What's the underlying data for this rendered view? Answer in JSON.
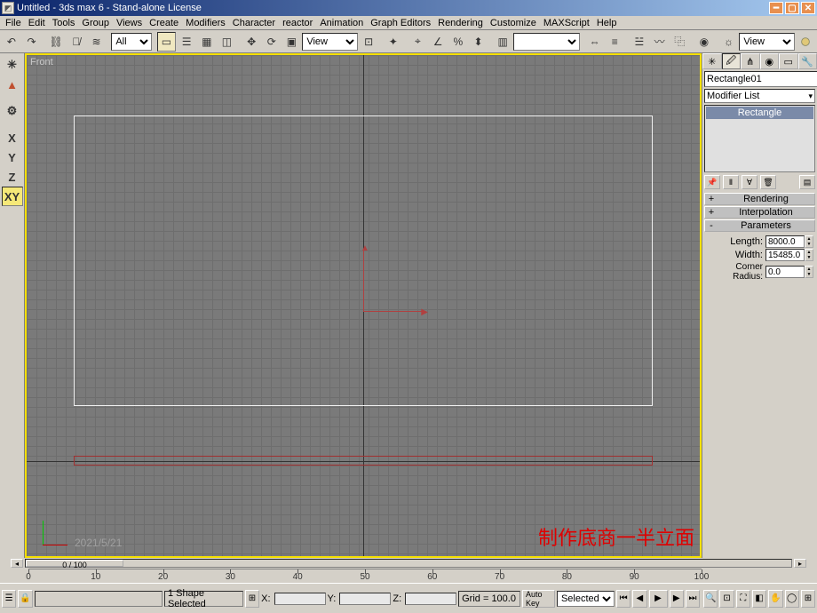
{
  "title": "Untitled - 3ds max 6 - Stand-alone License",
  "menu": [
    "File",
    "Edit",
    "Tools",
    "Group",
    "Views",
    "Create",
    "Modifiers",
    "Character",
    "reactor",
    "Animation",
    "Graph Editors",
    "Rendering",
    "Customize",
    "MAXScript",
    "Help"
  ],
  "toolbar": {
    "selset": "All",
    "refcoord": "View",
    "renderview": "View"
  },
  "axis": {
    "x": "X",
    "y": "Y",
    "z": "Z",
    "xy": "XY"
  },
  "viewport": {
    "label": "Front",
    "overlay_text": "制作底商一半立面",
    "watermark": "2021/5/21"
  },
  "cmd": {
    "object_name": "Rectangle01",
    "modlist_label": "Modifier List",
    "stack_item": "Rectangle",
    "rollouts": {
      "rendering": "Rendering",
      "interpolation": "Interpolation",
      "parameters": "Parameters"
    },
    "params": {
      "length_label": "Length:",
      "length": "8000.0",
      "width_label": "Width:",
      "width": "15485.0",
      "corner_label": "Corner Radius:",
      "corner": "0.0"
    }
  },
  "timeline": {
    "thumb": "0 / 100",
    "ticks": [
      "0",
      "10",
      "20",
      "30",
      "40",
      "50",
      "60",
      "70",
      "80",
      "90",
      "100"
    ]
  },
  "status": {
    "selinfo": "1 Shape Selected",
    "xl": "X:",
    "yl": "Y:",
    "zl": "Z:",
    "grid": "Grid = 100.0",
    "autokey_lbl": "Auto Key",
    "keyfilter": "Selected"
  }
}
